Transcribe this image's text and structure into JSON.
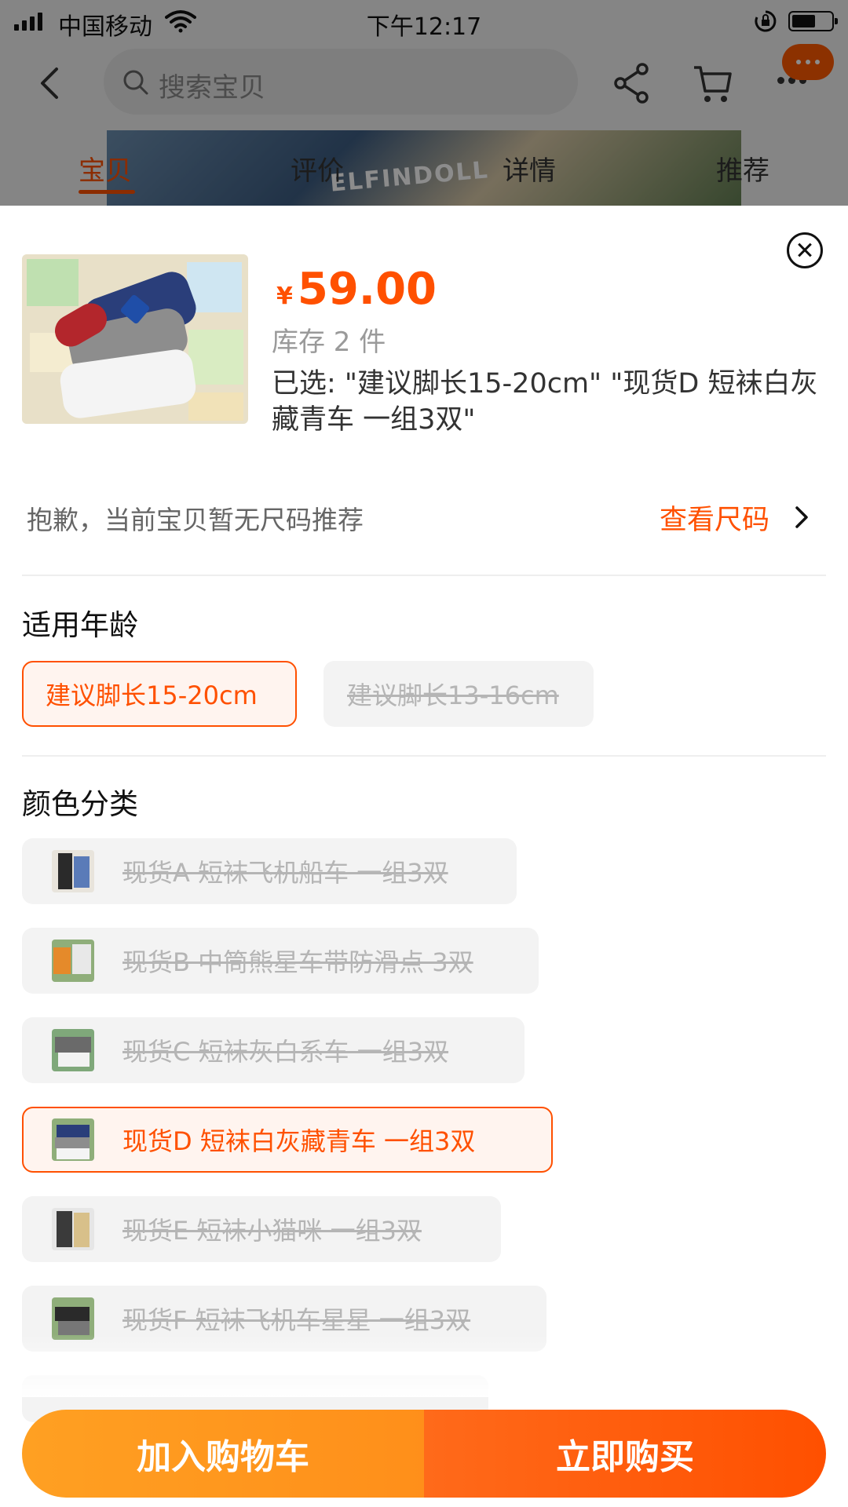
{
  "status_bar": {
    "carrier": "中国移动",
    "time": "下午12:17",
    "battery_level": 0.6
  },
  "nav": {
    "search_placeholder": "搜索宝贝"
  },
  "background_photo_text": "ELFINDOLL",
  "tabs": [
    {
      "label": "宝贝",
      "active": true
    },
    {
      "label": "评价",
      "active": false
    },
    {
      "label": "详情",
      "active": false
    },
    {
      "label": "推荐",
      "active": false
    }
  ],
  "product": {
    "currency": "¥",
    "price": "59.00",
    "stock": "库存 2 件",
    "selected": "已选: \"建议脚长15-20cm\" \"现货D 短袜白灰藏青车  一组3双\""
  },
  "size_row": {
    "message": "抱歉，当前宝贝暂无尺码推荐",
    "link": "查看尺码"
  },
  "age_section": {
    "title": "适用年龄",
    "options": [
      {
        "label": "建议脚长15-20cm",
        "state": "selected"
      },
      {
        "label": "建议脚长13-16cm",
        "state": "unavailable"
      }
    ]
  },
  "color_section": {
    "title": "颜色分类",
    "options": [
      {
        "label": "现货A 短袜飞机船车  一组3双",
        "state": "unavailable"
      },
      {
        "label": "现货B 中筒熊星车带防滑点 3双",
        "state": "unavailable"
      },
      {
        "label": "现货C 短袜灰白系车  一组3双",
        "state": "unavailable"
      },
      {
        "label": "现货D 短袜白灰藏青车  一组3双",
        "state": "selected"
      },
      {
        "label": "现货E 短袜小猫咪  一组3双",
        "state": "unavailable"
      },
      {
        "label": "现货F 短袜飞机车星星  一组3双",
        "state": "unavailable"
      }
    ]
  },
  "actions": {
    "add_to_cart": "加入购物车",
    "buy_now": "立即购买"
  },
  "colors": {
    "accent": "#ff5000",
    "cart_button": "#ff9a1f",
    "buy_button": "#ff5a10",
    "disabled_text": "#b5b5b5"
  }
}
